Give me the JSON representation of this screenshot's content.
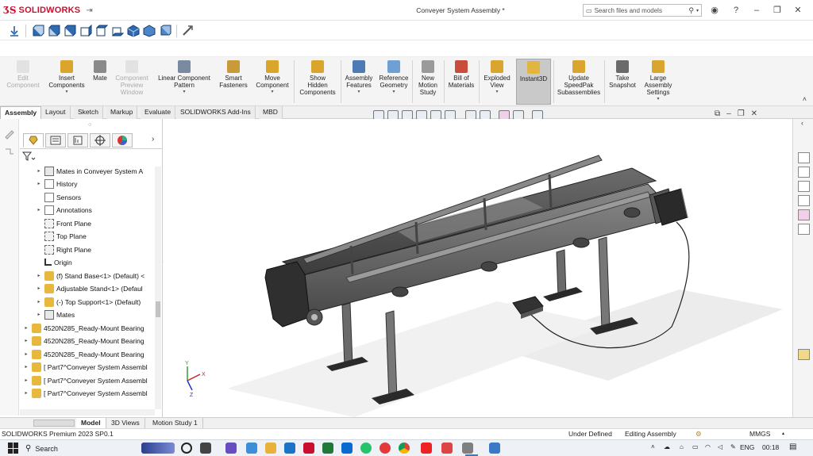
{
  "app": {
    "brand": "SOLIDWORKS",
    "doc_title": "Conveyer System Assembly *",
    "search_placeholder": "Search files and models"
  },
  "colors": {
    "brand_red": "#c8102e",
    "component_yellow": "#e8b73e",
    "selected_tool": "#c9c9c9"
  },
  "commands": [
    {
      "label": "Edit\nComponent",
      "state": "disabled",
      "icon": "edit-component-icon"
    },
    {
      "label": "Insert\nComponents",
      "state": "enabled",
      "icon": "insert-components-icon"
    },
    {
      "label": "Mate",
      "state": "enabled",
      "icon": "mate-icon"
    },
    {
      "label": "Component\nPreview\nWindow",
      "state": "disabled",
      "icon": "preview-window-icon"
    },
    {
      "label": "Linear Component\nPattern",
      "state": "enabled",
      "icon": "linear-pattern-icon"
    },
    {
      "label": "Smart\nFasteners",
      "state": "enabled",
      "icon": "smart-fasteners-icon"
    },
    {
      "label": "Move\nComponent",
      "state": "enabled",
      "icon": "move-component-icon"
    },
    {
      "label": "Show\nHidden\nComponents",
      "state": "enabled",
      "icon": "show-hidden-icon"
    },
    {
      "label": "Assembly\nFeatures",
      "state": "enabled",
      "icon": "assembly-features-icon"
    },
    {
      "label": "Reference\nGeometry",
      "state": "enabled",
      "icon": "reference-geometry-icon"
    },
    {
      "label": "New\nMotion\nStudy",
      "state": "enabled",
      "icon": "motion-study-icon"
    },
    {
      "label": "Bill of\nMaterials",
      "state": "enabled",
      "icon": "bom-icon"
    },
    {
      "label": "Exploded\nView",
      "state": "enabled",
      "icon": "exploded-view-icon"
    },
    {
      "label": "Instant3D",
      "state": "selected",
      "icon": "instant3d-icon"
    },
    {
      "label": "Update\nSpeedPak\nSubassemblies",
      "state": "enabled",
      "icon": "speedpak-icon"
    },
    {
      "label": "Take\nSnapshot",
      "state": "enabled",
      "icon": "snapshot-icon"
    },
    {
      "label": "Large\nAssembly\nSettings",
      "state": "enabled",
      "icon": "large-assembly-icon"
    }
  ],
  "ribbon_tabs": [
    "Assembly",
    "Layout",
    "Sketch",
    "Markup",
    "Evaluate",
    "SOLIDWORKS Add-Ins",
    "MBD"
  ],
  "tree": [
    {
      "label": "Mates in Conveyer System A",
      "icon": "mates",
      "expand": true
    },
    {
      "label": "History",
      "icon": "ann",
      "expand": true
    },
    {
      "label": "Sensors",
      "icon": "ann",
      "expand": false
    },
    {
      "label": "Annotations",
      "icon": "ann",
      "expand": true
    },
    {
      "label": "Front Plane",
      "icon": "plane",
      "expand": false
    },
    {
      "label": "Top Plane",
      "icon": "plane",
      "expand": false
    },
    {
      "label": "Right Plane",
      "icon": "plane",
      "expand": false
    },
    {
      "label": "Origin",
      "icon": "origin",
      "expand": false
    },
    {
      "label": "(f) Stand Base<1> (Default) <",
      "icon": "comp",
      "expand": true
    },
    {
      "label": "Adjustable Stand<1> (Defaul",
      "icon": "comp",
      "expand": true
    },
    {
      "label": "(-) Top Support<1> (Default)",
      "icon": "comp",
      "expand": true
    },
    {
      "label": "Mates",
      "icon": "mates",
      "expand": true
    },
    {
      "label": "4520N285_Ready-Mount Bearing",
      "icon": "comp",
      "expand": true,
      "level": 0
    },
    {
      "label": "4520N285_Ready-Mount Bearing",
      "icon": "comp",
      "expand": true,
      "level": 0
    },
    {
      "label": "4520N285_Ready-Mount Bearing",
      "icon": "comp",
      "expand": true,
      "level": 0
    },
    {
      "label": "[ Part7^Conveyer System Assembl",
      "icon": "comp",
      "expand": true,
      "level": 0
    },
    {
      "label": "[ Part7^Conveyer System Assembl",
      "icon": "comp",
      "expand": true,
      "level": 0
    },
    {
      "label": "[ Part7^Conveyer System Assembl",
      "icon": "comp",
      "expand": true,
      "level": 0
    }
  ],
  "model_tabs": [
    "Model",
    "3D Views",
    "Motion Study 1"
  ],
  "status": {
    "product": "SOLIDWORKS Premium 2023 SP0.1",
    "state": "Under Defined",
    "mode": "Editing Assembly",
    "units": "MMGS"
  },
  "taskbar": {
    "search": "Search",
    "lang": "ENG",
    "time": "00:18"
  }
}
